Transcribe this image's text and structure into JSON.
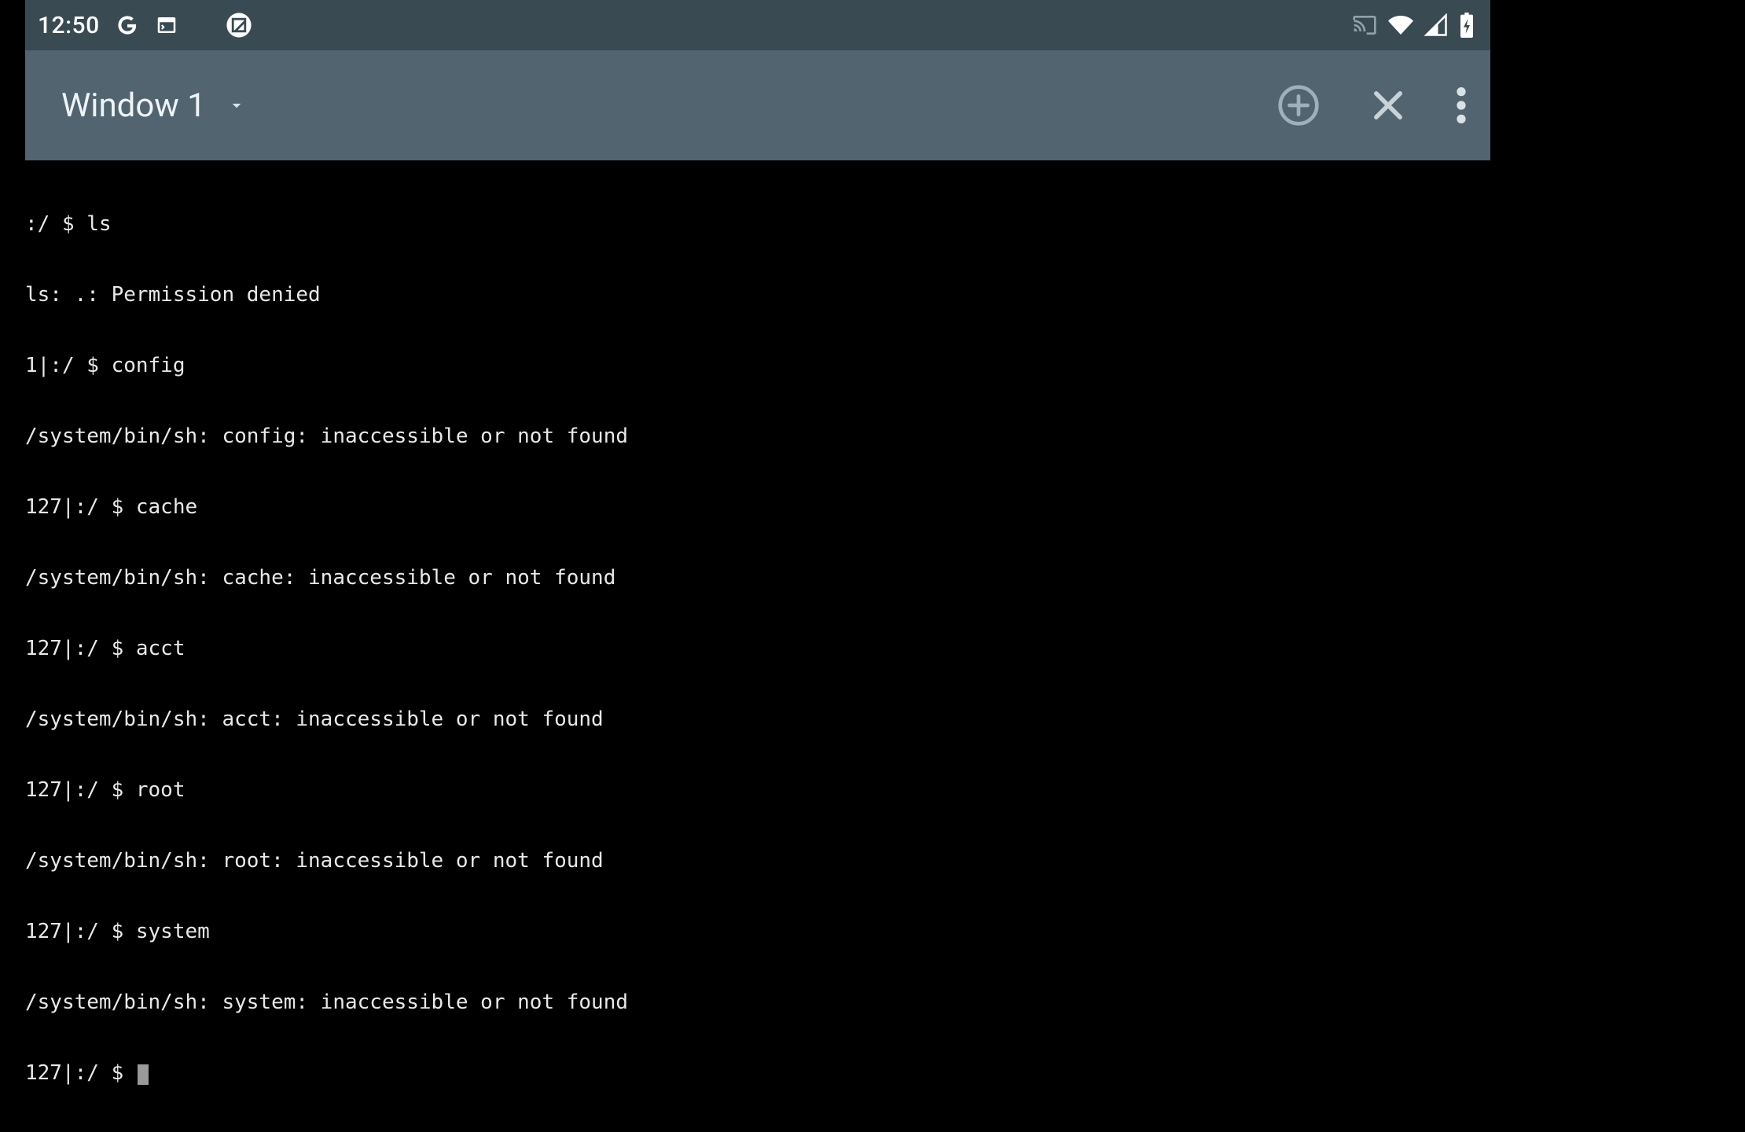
{
  "status_bar": {
    "time": "12:50"
  },
  "app_bar": {
    "window_title": "Window 1"
  },
  "terminal": {
    "lines": [
      ":/ $ ls",
      "ls: .: Permission denied",
      "1|:/ $ config",
      "/system/bin/sh: config: inaccessible or not found",
      "127|:/ $ cache",
      "/system/bin/sh: cache: inaccessible or not found",
      "127|:/ $ acct",
      "/system/bin/sh: acct: inaccessible or not found",
      "127|:/ $ root",
      "/system/bin/sh: root: inaccessible or not found",
      "127|:/ $ system",
      "/system/bin/sh: system: inaccessible or not found"
    ],
    "prompt": "127|:/ $ "
  }
}
